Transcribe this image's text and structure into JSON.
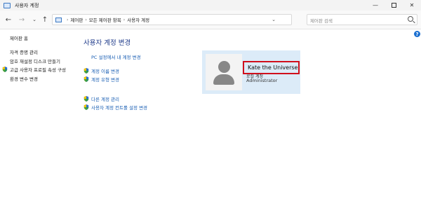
{
  "window": {
    "title": "사용자 계정",
    "minimize": "—",
    "close": "✕"
  },
  "nav": {
    "back": "←",
    "forward": "→",
    "recent": "⌄",
    "up": "↑",
    "refresh": "↻",
    "breadcrumbs": [
      "제어판",
      "모든 제어판 항목",
      "사용자 계정"
    ],
    "crumb_sep": "›",
    "chevron": "⌄"
  },
  "search": {
    "placeholder": "제어판 검색"
  },
  "help": "?",
  "sidebar": {
    "home": "제어판 홈",
    "items": [
      {
        "label": "자격 증명 관리",
        "icon": null
      },
      {
        "label": "암호 재설정 디스크 만들기",
        "icon": null
      },
      {
        "label": "고급 사용자 프로필 속성 구성",
        "icon": "shield-icon"
      },
      {
        "label": "환경 변수 변경",
        "icon": null
      }
    ]
  },
  "main": {
    "title": "사용자 계정 변경",
    "links": [
      {
        "label": "PC 설정에서 내 계정 변경",
        "icon": null
      },
      {
        "label": "계정 이름 변경",
        "icon": "shield-icon"
      },
      {
        "label": "계정 유형 변경",
        "icon": "shield-icon"
      },
      {
        "label": "다른 계정 관리",
        "icon": "shield-icon"
      },
      {
        "label": "사용자 계정 컨트롤 설정 변경",
        "icon": "shield-icon"
      }
    ]
  },
  "account": {
    "name": "Kate the Universe",
    "type": "로컬 계정",
    "role": "Administrator"
  },
  "colors": {
    "link": "#1a5fb4",
    "highlight_border": "#d10f1c",
    "card_bg": "#dcebf8"
  }
}
